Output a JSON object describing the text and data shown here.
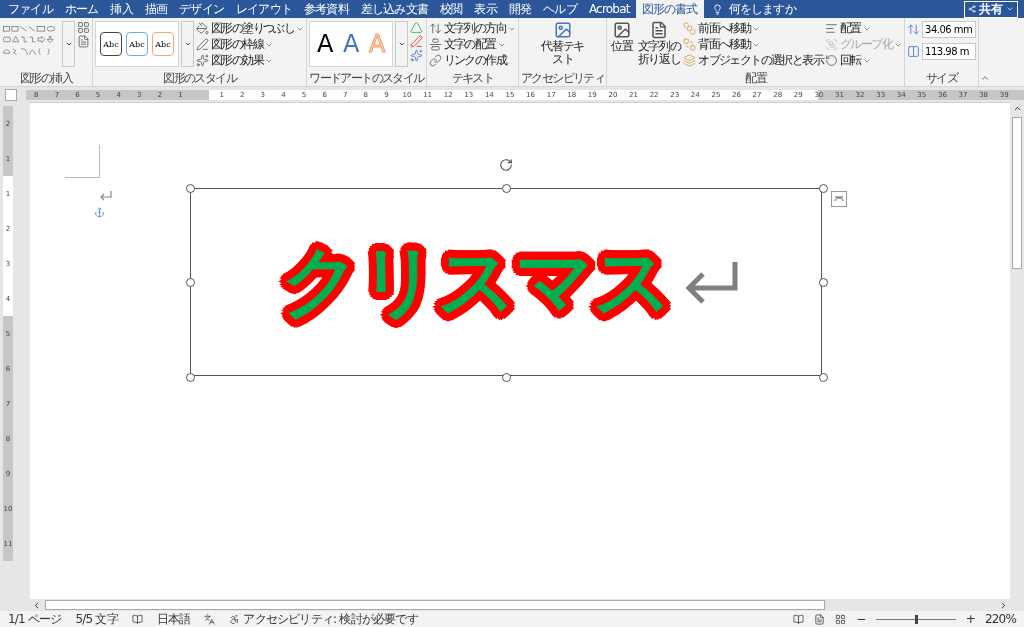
{
  "tabs": [
    {
      "label": "ファイル",
      "selected": false
    },
    {
      "label": "ホーム",
      "selected": false
    },
    {
      "label": "挿入",
      "selected": false
    },
    {
      "label": "描画",
      "selected": false
    },
    {
      "label": "デザイン",
      "selected": false
    },
    {
      "label": "レイアウト",
      "selected": false
    },
    {
      "label": "参考資料",
      "selected": false
    },
    {
      "label": "差し込み文書",
      "selected": false
    },
    {
      "label": "校閲",
      "selected": false
    },
    {
      "label": "表示",
      "selected": false
    },
    {
      "label": "開発",
      "selected": false
    },
    {
      "label": "ヘルプ",
      "selected": false
    },
    {
      "label": "Acrobat",
      "selected": false
    },
    {
      "label": "図形の書式",
      "selected": true
    }
  ],
  "tell_me": {
    "placeholder": "何をしますか"
  },
  "share_button": "共有",
  "ribbon": {
    "insert_shapes": {
      "label": "図形の挿入"
    },
    "shape_styles": {
      "samples": [
        {
          "text": "Abc",
          "kind": "dark"
        },
        {
          "text": "Abc",
          "kind": "blue"
        },
        {
          "text": "Abc",
          "kind": "orange"
        }
      ],
      "commands": [
        "図形の塗りつぶし",
        "図形の枠線",
        "図形の効果"
      ],
      "label": "図形のスタイル"
    },
    "wordart_styles": {
      "samples": [
        {
          "text": "A",
          "kind": "dark"
        },
        {
          "text": "A",
          "kind": "blue"
        },
        {
          "text": "A",
          "kind": "orange"
        }
      ],
      "label": "ワードアートのスタイル"
    },
    "text": {
      "commands": [
        "文字列の方向",
        "文字の配置",
        "リンクの作成"
      ],
      "label": "テキスト"
    },
    "accessibility": {
      "button": "代替テキスト",
      "label": "アクセシビリティ"
    },
    "arrange": {
      "buttons": [
        "位置",
        "文字列の折り返し"
      ],
      "commands": [
        {
          "label": "前面へ移動",
          "disabled": false
        },
        {
          "label": "背面へ移動",
          "disabled": false
        },
        {
          "label": "オブジェクトの選択と表示",
          "disabled": false
        },
        {
          "label": "配置",
          "disabled": false
        },
        {
          "label": "グループ化",
          "disabled": true
        },
        {
          "label": "回転",
          "disabled": false
        }
      ],
      "label": "配置"
    },
    "size": {
      "height": "34.06 mm",
      "width": "113.98 m",
      "label": "サイズ"
    }
  },
  "ruler": {
    "left_numbers": [
      "8",
      "7",
      "6",
      "5",
      "4",
      "3",
      "2",
      "1"
    ],
    "numbers": [
      "1",
      "2",
      "3",
      "4",
      "5",
      "6",
      "7",
      "8",
      "9",
      "10",
      "11",
      "12",
      "13",
      "14",
      "15",
      "16",
      "17",
      "18",
      "19",
      "20",
      "21",
      "22",
      "23",
      "24",
      "25",
      "26",
      "27",
      "28",
      "29",
      "30",
      "31",
      "32",
      "33",
      "34",
      "35",
      "36",
      "37",
      "38",
      "39"
    ]
  },
  "vertical_ruler": {
    "numbers": [
      "2",
      "1",
      "1",
      "2",
      "3",
      "4",
      "5",
      "6",
      "7",
      "8",
      "9",
      "10",
      "11"
    ]
  },
  "document": {
    "wordart_text": "クリスマス"
  },
  "status_bar": {
    "page": "1/1 ページ",
    "words": "5/5 文字",
    "language": "日本語",
    "accessibility": "アクセシビリティ: 検討が必要です",
    "zoom_out": "−",
    "zoom_in": "+",
    "zoom": {
      "level": 0.5,
      "value": "220%"
    }
  }
}
